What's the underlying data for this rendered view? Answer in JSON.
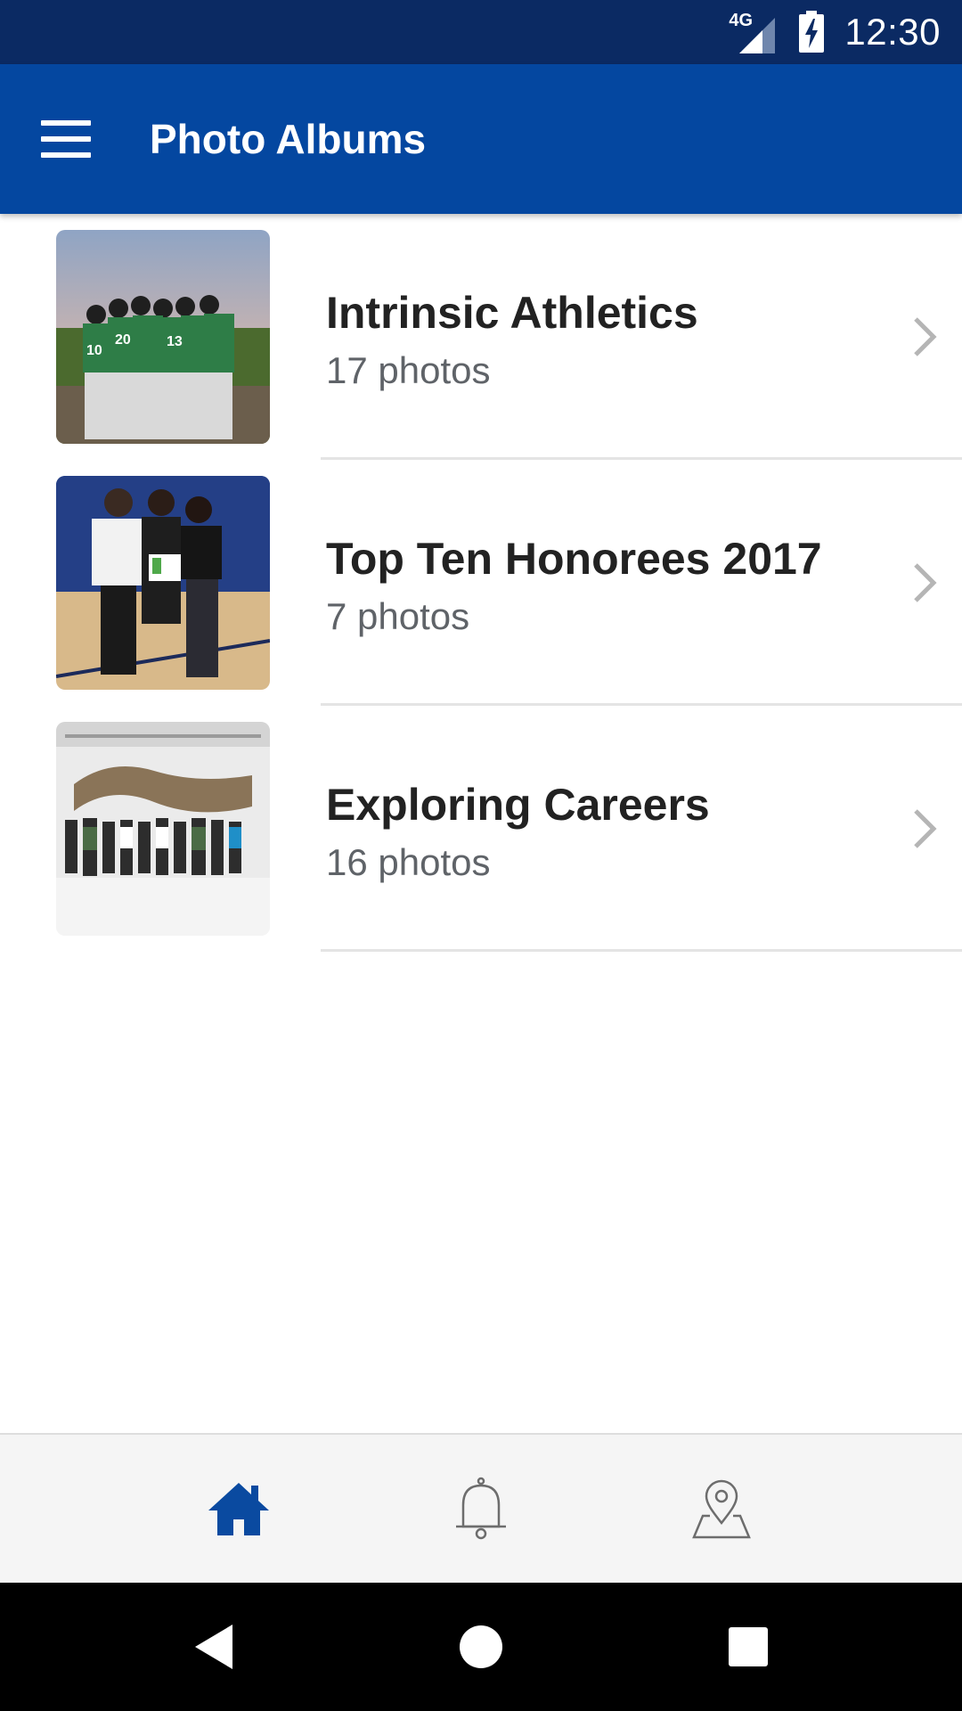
{
  "status_bar": {
    "network_label": "4G",
    "time": "12:30"
  },
  "app_bar": {
    "title": "Photo Albums",
    "menu_icon": "hamburger-menu-icon"
  },
  "albums": [
    {
      "title": "Intrinsic Athletics",
      "count": "17 photos"
    },
    {
      "title": "Top Ten Honorees 2017",
      "count": "7 photos"
    },
    {
      "title": "Exploring Careers",
      "count": "16 photos"
    }
  ],
  "bottom_nav": {
    "items": [
      {
        "icon": "home-icon",
        "active": true
      },
      {
        "icon": "bell-icon",
        "active": false
      },
      {
        "icon": "map-pin-icon",
        "active": false
      }
    ]
  },
  "system_nav": {
    "items": [
      "back-icon",
      "home-circle-icon",
      "recents-icon"
    ]
  },
  "colors": {
    "status_bar": "#0b2a63",
    "app_bar": "#0447a0",
    "active_nav": "#0a4aa0",
    "inactive_nav": "#6d6d6d",
    "divider": "#e4e4e4"
  }
}
